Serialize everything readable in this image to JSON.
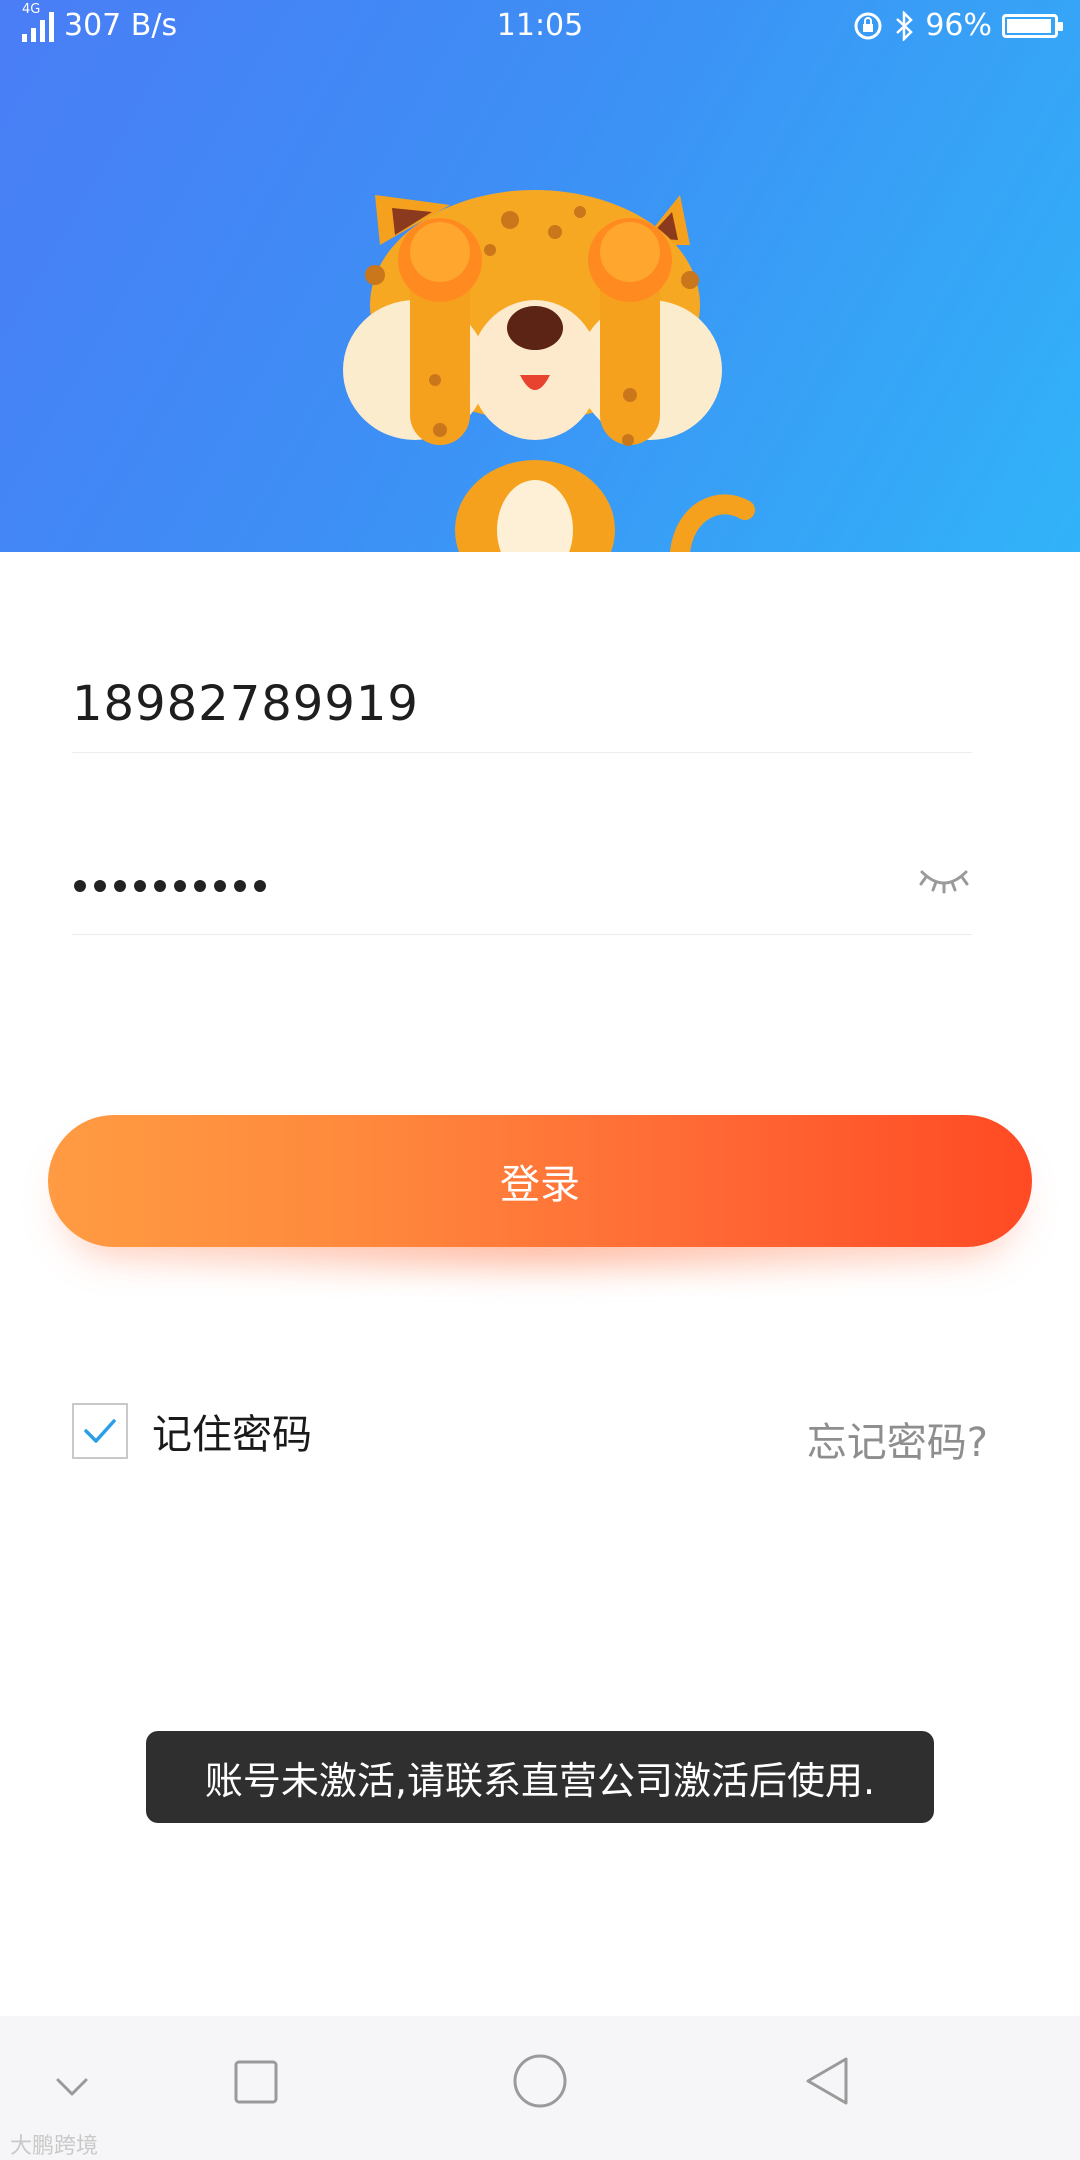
{
  "status_bar": {
    "network_type": "4G",
    "speed": "307 B/s",
    "time": "11:05",
    "battery": "96%"
  },
  "login_form": {
    "phone_value": "18982789919",
    "password_masked": "••••••••••",
    "login_button_label": "登录",
    "remember_label": "记住密码",
    "remember_checked": true,
    "forgot_label": "忘记密码?"
  },
  "toast": {
    "message": "账号未激活,请联系直营公司激活后使用."
  },
  "watermark": "大鹏跨境",
  "colors": {
    "header_start": "#4a7df6",
    "header_end": "#31b3f8",
    "button_start": "#ff9b42",
    "button_end": "#ff4a24",
    "check_color": "#2a9ee8",
    "toast_bg": "#2f2f2f"
  },
  "icons": {
    "status": [
      "signal-icon",
      "alarm-lock-icon",
      "bluetooth-icon",
      "battery-icon"
    ],
    "navigation": [
      "chevron-down-icon",
      "recents-square-icon",
      "home-circle-icon",
      "back-triangle-icon"
    ],
    "form": [
      "eye-closed-icon",
      "checkmark-icon"
    ]
  }
}
